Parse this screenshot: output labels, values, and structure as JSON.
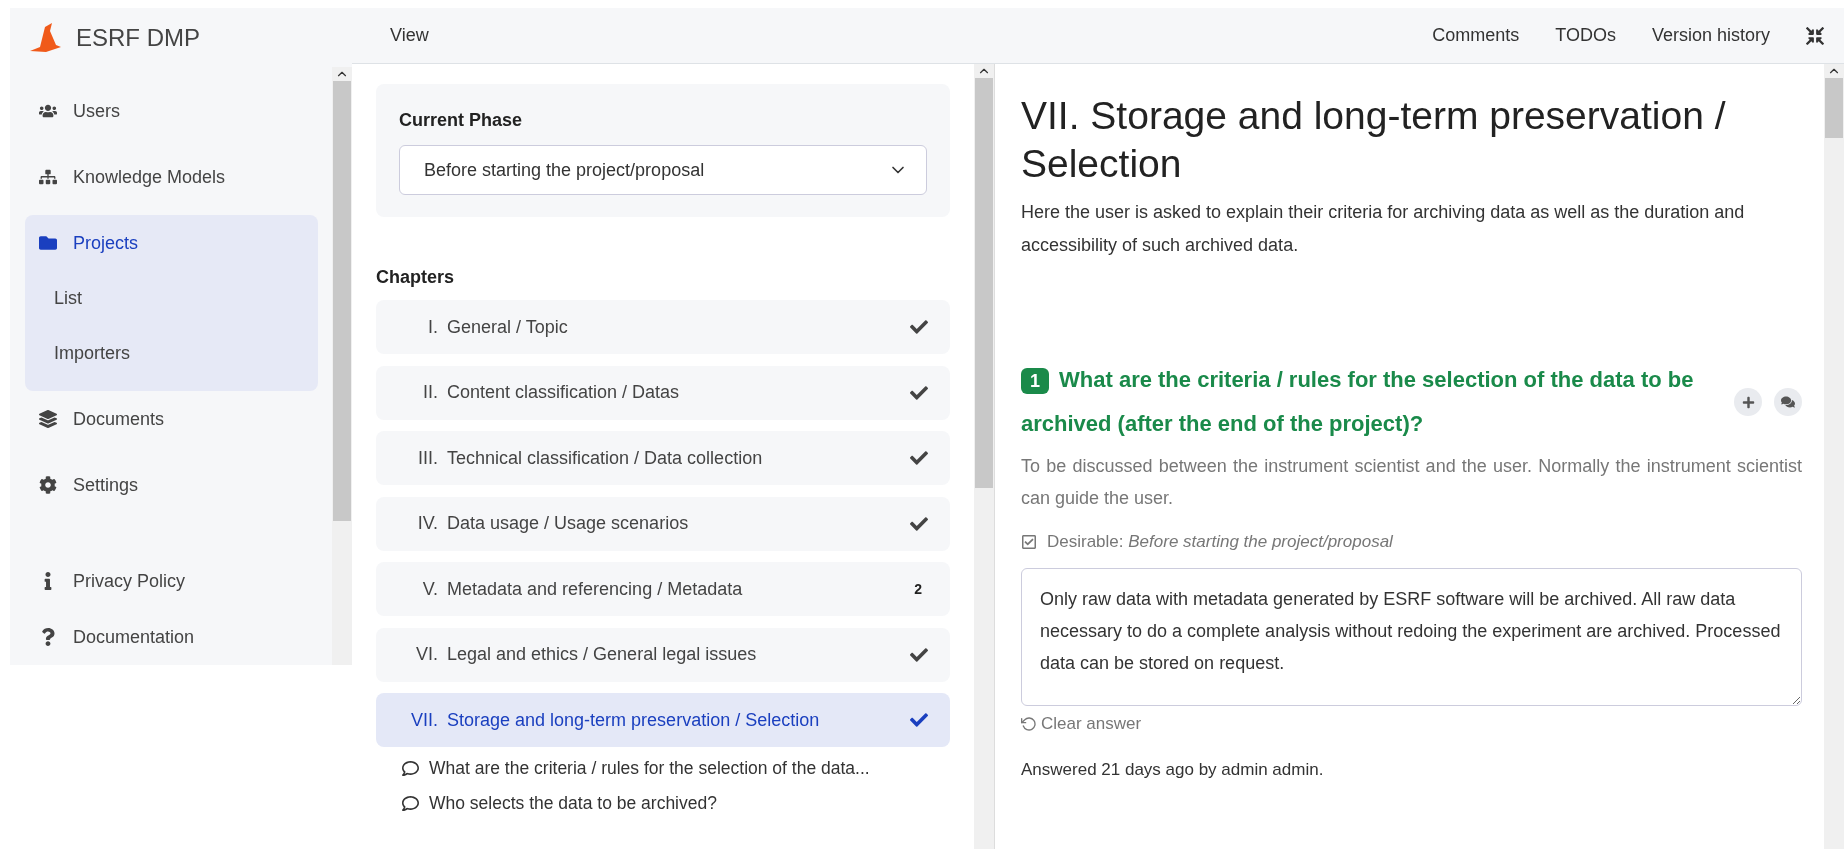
{
  "app": {
    "name": "ESRF DMP"
  },
  "sidebar": {
    "items": [
      {
        "label": "Users",
        "selected": false
      },
      {
        "label": "Knowledge Models",
        "selected": false
      },
      {
        "label": "Projects",
        "selected": true,
        "children": [
          "List",
          "Importers"
        ]
      },
      {
        "label": "Documents",
        "selected": false
      },
      {
        "label": "Settings",
        "selected": false
      }
    ],
    "bottom_items": [
      "Privacy Policy",
      "Documentation"
    ]
  },
  "toolbar": {
    "left": [
      "View"
    ],
    "right": [
      "Comments",
      "TODOs",
      "Version history"
    ]
  },
  "phase": {
    "label": "Current Phase",
    "value": "Before starting the project/proposal"
  },
  "chapters": {
    "title": "Chapters",
    "items": [
      {
        "number": "I.",
        "title": "General / Topic",
        "done": true,
        "selected": false
      },
      {
        "number": "II.",
        "title": "Content classification / Datas",
        "done": true,
        "selected": false
      },
      {
        "number": "III.",
        "title": "Technical classification / Data collection",
        "done": true,
        "selected": false
      },
      {
        "number": "IV.",
        "title": "Data usage / Usage scenarios",
        "done": true,
        "selected": false
      },
      {
        "number": "V.",
        "title": "Metadata and referencing / Metadata",
        "done": false,
        "badge": "2",
        "selected": false
      },
      {
        "number": "VI.",
        "title": "Legal and ethics / General legal issues",
        "done": true,
        "selected": false
      },
      {
        "number": "VII.",
        "title": "Storage and long-term preservation / Selection",
        "done": true,
        "selected": true,
        "questions": [
          "What are the criteria / rules for the selection of the data...",
          "Who selects the data to be archived?"
        ]
      }
    ]
  },
  "content": {
    "title": "VII. Storage and long-term preservation / Selection",
    "description": "Here the user is asked to explain their criteria for archiving data as well as the duration and accessibility of such archived data.",
    "question": {
      "number": "1",
      "text": "What are the criteria / rules for the selection of the data to be archived (after the end of the project)?",
      "hint": "To be discussed between the instrument scientist and the user. Normally the instrument scientist can guide the user.",
      "desirable_label": "Desirable:",
      "desirable_phase": "Before starting the project/proposal",
      "answer": "Only raw data with metadata generated by ESRF software will be archived. All raw data necessary to do a complete analysis without redoing the experiment are archived. Processed data can be stored on request.",
      "clear_label": "Clear answer",
      "answered": "Answered 21 days ago by admin admin."
    }
  }
}
